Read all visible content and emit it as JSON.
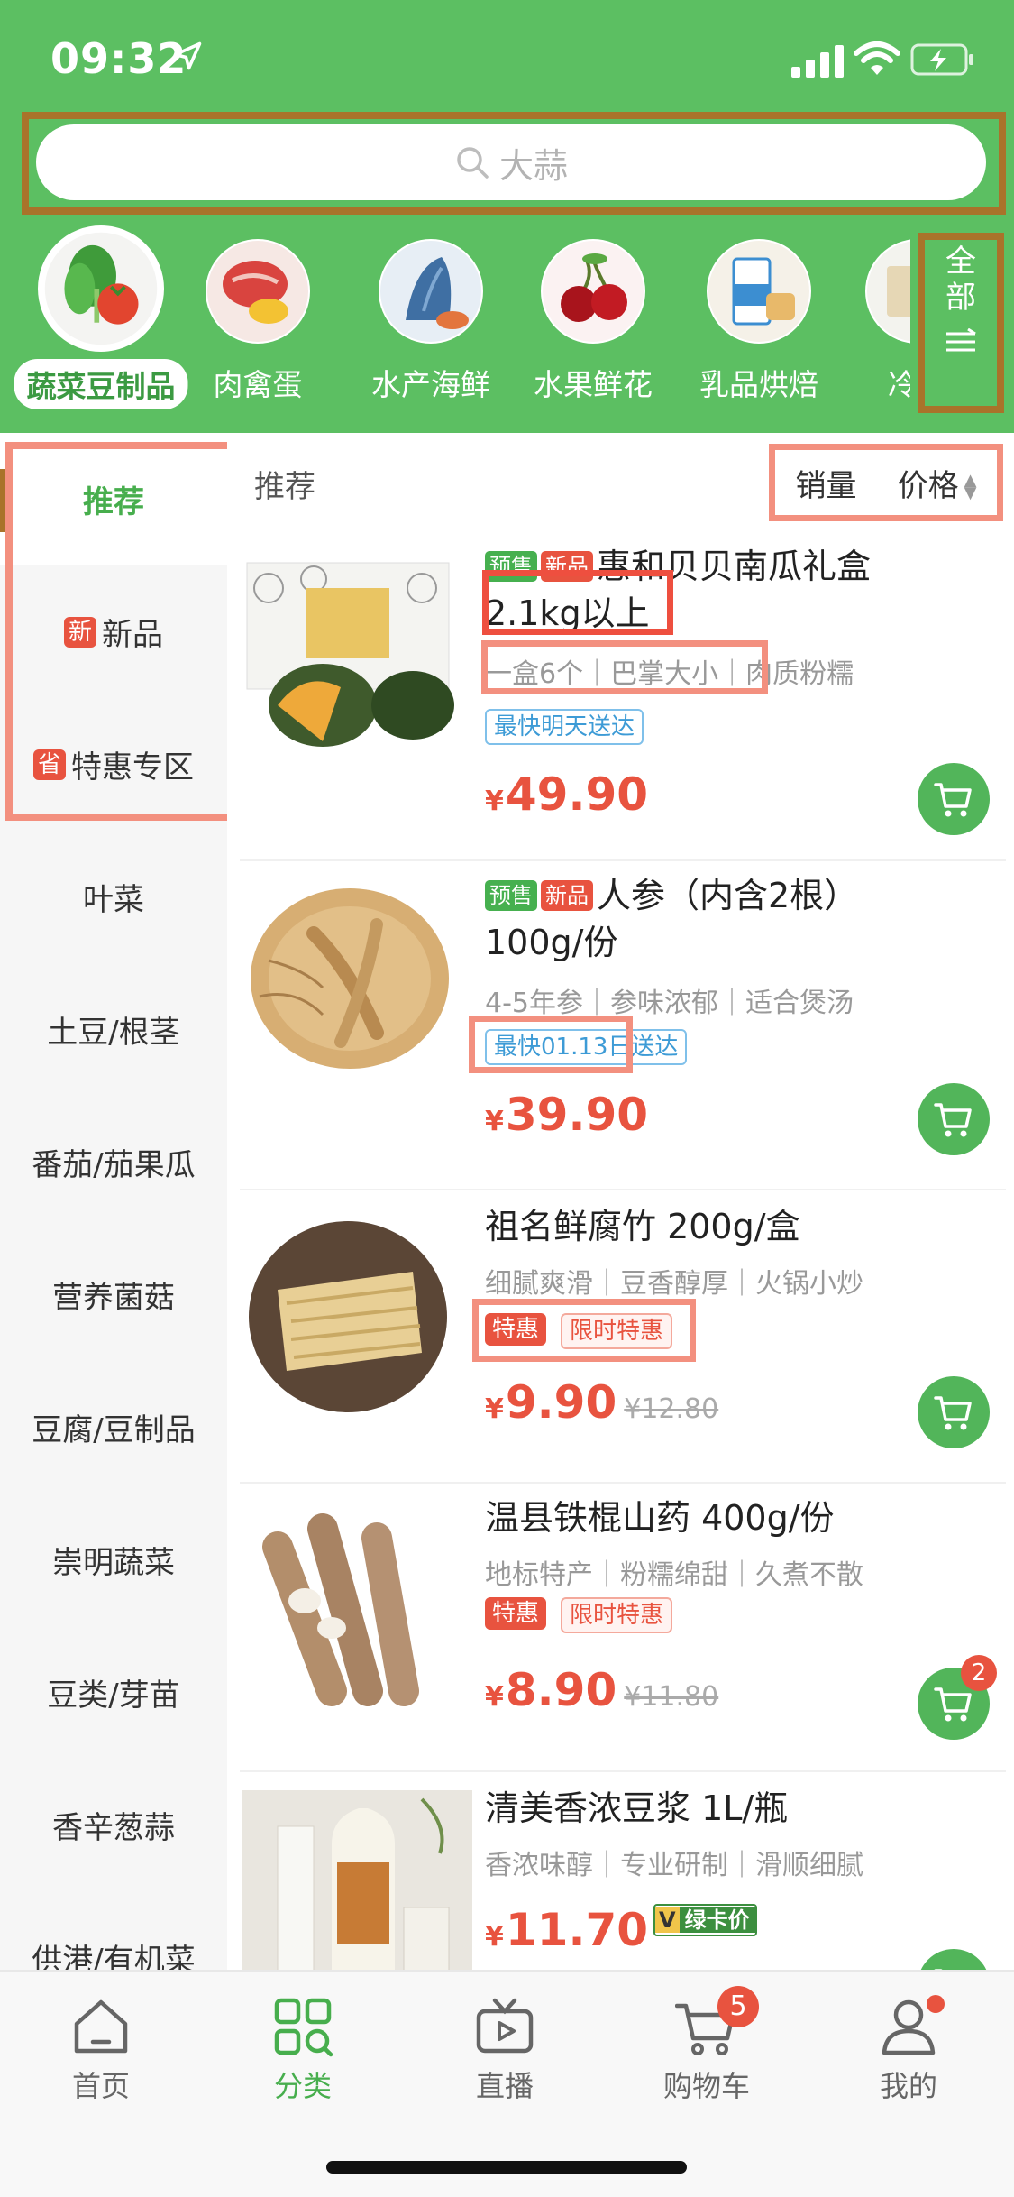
{
  "status_bar": {
    "time": "09:32"
  },
  "search": {
    "placeholder": "大蒜"
  },
  "categories": [
    {
      "label": "蔬菜豆制品",
      "active": true
    },
    {
      "label": "肉禽蛋"
    },
    {
      "label": "水产海鲜"
    },
    {
      "label": "水果鲜花"
    },
    {
      "label": "乳品烘焙"
    },
    {
      "label": "冷冻"
    }
  ],
  "all_button": {
    "line1": "全",
    "line2": "部"
  },
  "sidebar": {
    "items": [
      {
        "label": "推荐",
        "active": true
      },
      {
        "label": "新品",
        "tag": "新"
      },
      {
        "label": "特惠专区",
        "tag": "省"
      },
      {
        "label": "叶菜"
      },
      {
        "label": "土豆/根茎"
      },
      {
        "label": "番茄/茄果瓜"
      },
      {
        "label": "营养菌菇"
      },
      {
        "label": "豆腐/豆制品"
      },
      {
        "label": "崇明蔬菜"
      },
      {
        "label": "豆类/芽苗"
      },
      {
        "label": "香辛葱蒜"
      },
      {
        "label": "供港/有机菜"
      }
    ]
  },
  "main": {
    "subheader": "推荐",
    "sort_sales": "销量",
    "sort_price": "价格"
  },
  "products": [
    {
      "badge_presale": "预售",
      "badge_new": "新品",
      "title": "惠和贝贝南瓜礼盒2.1kg以上",
      "desc": "一盒6个｜巴掌大小｜肉质粉糯",
      "chip": "最快明天送达",
      "currency": "¥",
      "price": "49.90"
    },
    {
      "badge_presale": "预售",
      "badge_new": "新品",
      "title": "人参（内含2根）100g/份",
      "desc": "4-5年参｜参味浓郁｜适合煲汤",
      "chip": "最快01.13日送达",
      "currency": "¥",
      "price": "39.90"
    },
    {
      "title": "祖名鲜腐竹 200g/盒",
      "desc": "细腻爽滑｜豆香醇厚｜火锅小炒",
      "chip_sale": "特惠",
      "chip_limit": "限时特惠",
      "currency": "¥",
      "price": "9.90",
      "original_price": "¥12.80"
    },
    {
      "title": "温县铁棍山药 400g/份",
      "desc": "地标特产｜粉糯绵甜｜久煮不散",
      "chip_sale": "特惠",
      "chip_limit": "限时特惠",
      "currency": "¥",
      "price": "8.90",
      "original_price": "¥11.80",
      "cart_count": "2"
    },
    {
      "title": "清美香浓豆浆 1L/瓶",
      "desc": "香浓味醇｜专业研制｜滑顺细腻",
      "currency": "¥",
      "price": "11.70",
      "vip_v": "V",
      "vip_label": "绿卡价"
    }
  ],
  "tabbar": {
    "tabs": [
      {
        "label": "首页",
        "icon": "home-icon"
      },
      {
        "label": "分类",
        "icon": "category-icon",
        "active": true
      },
      {
        "label": "直播",
        "icon": "live-icon"
      },
      {
        "label": "购物车",
        "icon": "cart-icon",
        "badge": "5"
      },
      {
        "label": "我的",
        "icon": "profile-icon"
      }
    ]
  },
  "colors": {
    "brand_green": "#5cbf62",
    "price_red": "#e8533f",
    "annotation_outline_brown": "#a9732a",
    "annotation_outline_salmon": "#f3907f"
  }
}
